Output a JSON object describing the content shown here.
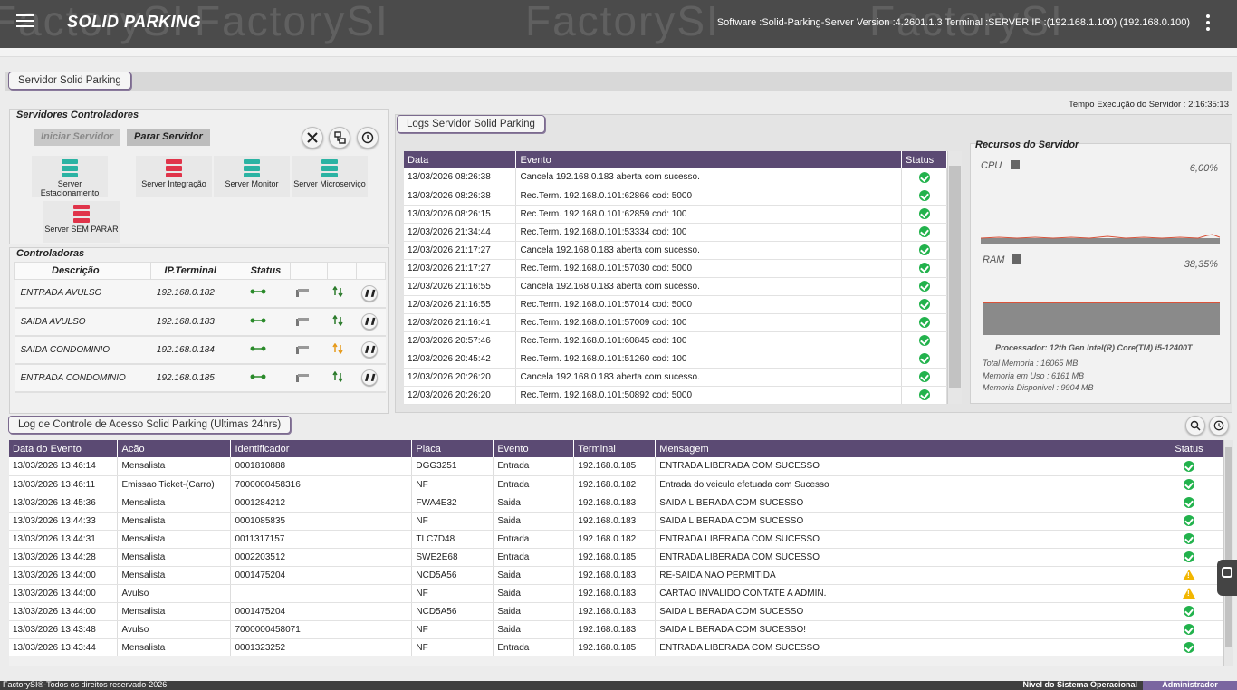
{
  "header": {
    "brand": "SOLID PARKING",
    "watermark": "FactorySI",
    "software_info": "Software :Solid-Parking-Server Version :4.2601.1.3 Terminal :SERVER IP :(192.168.1.100) (192.168.0.100)"
  },
  "page_tab": "Servidor Solid Parking",
  "tempo": "Tempo Execução do Servidor : 2:16:35:13",
  "servidores": {
    "title": "Servidores Controladores",
    "iniciar": "Iniciar Servidor",
    "parar": "Parar Servidor",
    "items": [
      {
        "label": "Server Estacionamento",
        "color": "#2bb3a3"
      },
      {
        "label": "Server Integração",
        "color": "#e0344a"
      },
      {
        "label": "Server Monitor",
        "color": "#2bb3a3"
      },
      {
        "label": "Server Microserviço",
        "color": "#2bb3a3"
      },
      {
        "label": "Server SEM PARAR",
        "color": "#e0344a"
      }
    ]
  },
  "controladoras": {
    "title": "Controladoras",
    "headers": [
      "Descrição",
      "IP.Terminal",
      "Status"
    ],
    "rows": [
      {
        "desc": "ENTRADA AVULSO",
        "ip": "192.168.0.182"
      },
      {
        "desc": "SAIDA AVULSO",
        "ip": "192.168.0.183"
      },
      {
        "desc": "SAIDA CONDOMINIO",
        "ip": "192.168.0.184"
      },
      {
        "desc": "ENTRADA CONDOMINIO",
        "ip": "192.168.0.185"
      }
    ]
  },
  "logs": {
    "tab": "Logs Servidor Solid Parking",
    "headers": [
      "Data",
      "Evento",
      "Status"
    ],
    "rows": [
      [
        "13/03/2026 08:26:38",
        "Cancela 192.168.0.183 aberta com sucesso."
      ],
      [
        "13/03/2026 08:26:38",
        "Rec.Term. 192.168.0.101:62866 cod: 5000"
      ],
      [
        "13/03/2026 08:26:15",
        "Rec.Term. 192.168.0.101:62859 cod: 100"
      ],
      [
        "12/03/2026 21:34:44",
        "Rec.Term. 192.168.0.101:53334 cod: 100"
      ],
      [
        "12/03/2026 21:17:27",
        "Cancela 192.168.0.183 aberta com sucesso."
      ],
      [
        "12/03/2026 21:17:27",
        "Rec.Term. 192.168.0.101:57030 cod: 5000"
      ],
      [
        "12/03/2026 21:16:55",
        "Cancela 192.168.0.183 aberta com sucesso."
      ],
      [
        "12/03/2026 21:16:55",
        "Rec.Term. 192.168.0.101:57014 cod: 5000"
      ],
      [
        "12/03/2026 21:16:41",
        "Rec.Term. 192.168.0.101:57009 cod: 100"
      ],
      [
        "12/03/2026 20:57:46",
        "Rec.Term. 192.168.0.101:60845 cod: 100"
      ],
      [
        "12/03/2026 20:45:42",
        "Rec.Term. 192.168.0.101:51260 cod: 100"
      ],
      [
        "12/03/2026 20:26:20",
        "Cancela 192.168.0.183 aberta com sucesso."
      ],
      [
        "12/03/2026 20:26:20",
        "Rec.Term. 192.168.0.101:50892 cod: 5000"
      ]
    ]
  },
  "recursos": {
    "title": "Recursos do Servidor",
    "cpu_label": "CPU",
    "cpu_value": "6,00%",
    "ram_label": "RAM",
    "ram_value": "38,35%",
    "processador": "Processador: 12th Gen Intel(R) Core(TM) i5-12400T",
    "total_mem": "Total Memoria : 16065 MB",
    "mem_uso": "Memoria em Uso : 6161 MB",
    "mem_disp": "Memoria Disponivel : 9904 MB"
  },
  "acesso": {
    "tab": "Log de Controle de Acesso Solid Parking (Ultimas 24hrs)",
    "headers": [
      "Data do Evento",
      "Acão",
      "Identificador",
      "Placa",
      "Evento",
      "Terminal",
      "Mensagem",
      "Status"
    ],
    "rows": [
      [
        "13/03/2026 13:46:14",
        "Mensalista",
        "0001810888",
        "DGG3251",
        "Entrada",
        "192.168.0.185",
        "ENTRADA LIBERADA COM SUCESSO",
        "ok"
      ],
      [
        "13/03/2026 13:46:11",
        "Emissao Ticket-(Carro)",
        "7000000458316",
        "NF",
        "Entrada",
        "192.168.0.182",
        "Entrada do veiculo efetuada com Sucesso",
        "ok"
      ],
      [
        "13/03/2026 13:45:36",
        "Mensalista",
        "0001284212",
        "FWA4E32",
        "Saida",
        "192.168.0.183",
        "SAIDA LIBERADA COM SUCESSO",
        "ok"
      ],
      [
        "13/03/2026 13:44:33",
        "Mensalista",
        "0001085835",
        "NF",
        "Saida",
        "192.168.0.183",
        "SAIDA LIBERADA COM SUCESSO",
        "ok"
      ],
      [
        "13/03/2026 13:44:31",
        "Mensalista",
        "0011317157",
        "TLC7D48",
        "Entrada",
        "192.168.0.182",
        "ENTRADA LIBERADA COM SUCESSO",
        "ok"
      ],
      [
        "13/03/2026 13:44:28",
        "Mensalista",
        "0002203512",
        "SWE2E68",
        "Entrada",
        "192.168.0.185",
        "ENTRADA LIBERADA COM SUCESSO",
        "ok"
      ],
      [
        "13/03/2026 13:44:00",
        "Mensalista",
        "0001475204",
        "NCD5A56",
        "Saida",
        "192.168.0.183",
        "RE-SAIDA NAO PERMITIDA",
        "warn"
      ],
      [
        "13/03/2026 13:44:00",
        "Avulso",
        "",
        "NF",
        "Saida",
        "192.168.0.183",
        "CARTAO INVALIDO CONTATE A ADMIN.",
        "warn"
      ],
      [
        "13/03/2026 13:44:00",
        "Mensalista",
        "0001475204",
        "NCD5A56",
        "Saida",
        "192.168.0.183",
        "SAIDA LIBERADA COM SUCESSO",
        "ok"
      ],
      [
        "13/03/2026 13:43:48",
        "Avulso",
        "7000000458071",
        "NF",
        "Saida",
        "192.168.0.183",
        "SAIDA LIBERADA COM SUCESSO!",
        "ok"
      ],
      [
        "13/03/2026 13:43:44",
        "Mensalista",
        "0001323252",
        "NF",
        "Entrada",
        "192.168.0.185",
        "ENTRADA LIBERADA COM SUCESSO",
        "ok"
      ]
    ]
  },
  "footer": {
    "copyright": "FactorySI®-Todos os direitos reservado-2026",
    "nivel": "Nivel do Sistema Operacional",
    "role": "Administrador"
  }
}
